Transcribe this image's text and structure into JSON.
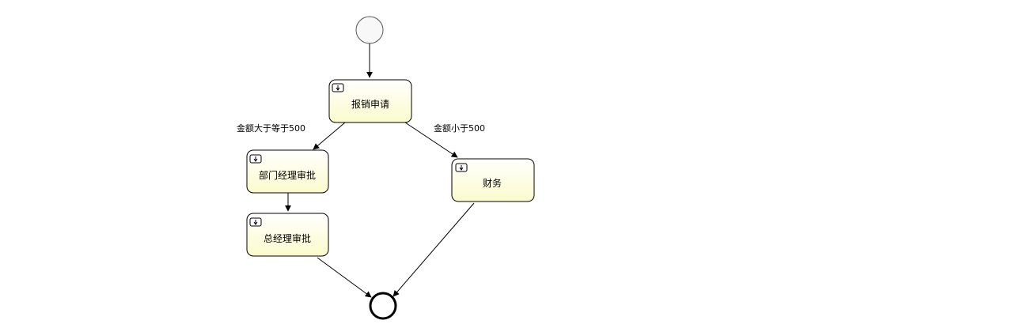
{
  "diagram": {
    "start_event": {},
    "end_event": {},
    "tasks": {
      "apply": {
        "label": "报销申请"
      },
      "dept_manager": {
        "label": "部门经理审批"
      },
      "general_manager": {
        "label": "总经理审批"
      },
      "finance": {
        "label": "财务"
      }
    },
    "edges": {
      "to_dept": {
        "label": "金额大于等于500"
      },
      "to_finance": {
        "label": "金额小于500"
      }
    },
    "colors": {
      "task_fill_top": "#ffffff",
      "task_fill_bottom": "#fbfbcc",
      "stroke": "#000000",
      "start_fill": "#f8f8f8"
    },
    "icons": {
      "task_marker": "user-task-icon"
    }
  }
}
